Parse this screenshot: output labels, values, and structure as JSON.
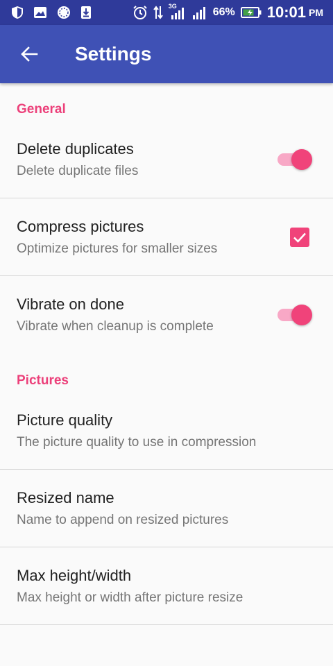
{
  "status_bar": {
    "network": "3G",
    "battery": "66%",
    "time": "10:01",
    "ampm": "PM"
  },
  "app_bar": {
    "title": "Settings"
  },
  "sections": {
    "general": "General",
    "pictures": "Pictures"
  },
  "prefs": {
    "delete_duplicates": {
      "title": "Delete duplicates",
      "summary": "Delete duplicate files",
      "enabled": true
    },
    "compress_pictures": {
      "title": "Compress pictures",
      "summary": "Optimize pictures for smaller sizes",
      "checked": true
    },
    "vibrate_on_done": {
      "title": "Vibrate on done",
      "summary": "Vibrate when cleanup is complete",
      "enabled": true
    },
    "picture_quality": {
      "title": "Picture quality",
      "summary": "The picture quality to use in compression"
    },
    "resized_name": {
      "title": "Resized name",
      "summary": "Name to append on resized pictures"
    },
    "max_size": {
      "title": "Max height/width",
      "summary": "Max height or width after picture resize"
    }
  },
  "colors": {
    "status_bar": "#2f3a9a",
    "app_bar": "#3f51b5",
    "accent": "#f0437a"
  }
}
